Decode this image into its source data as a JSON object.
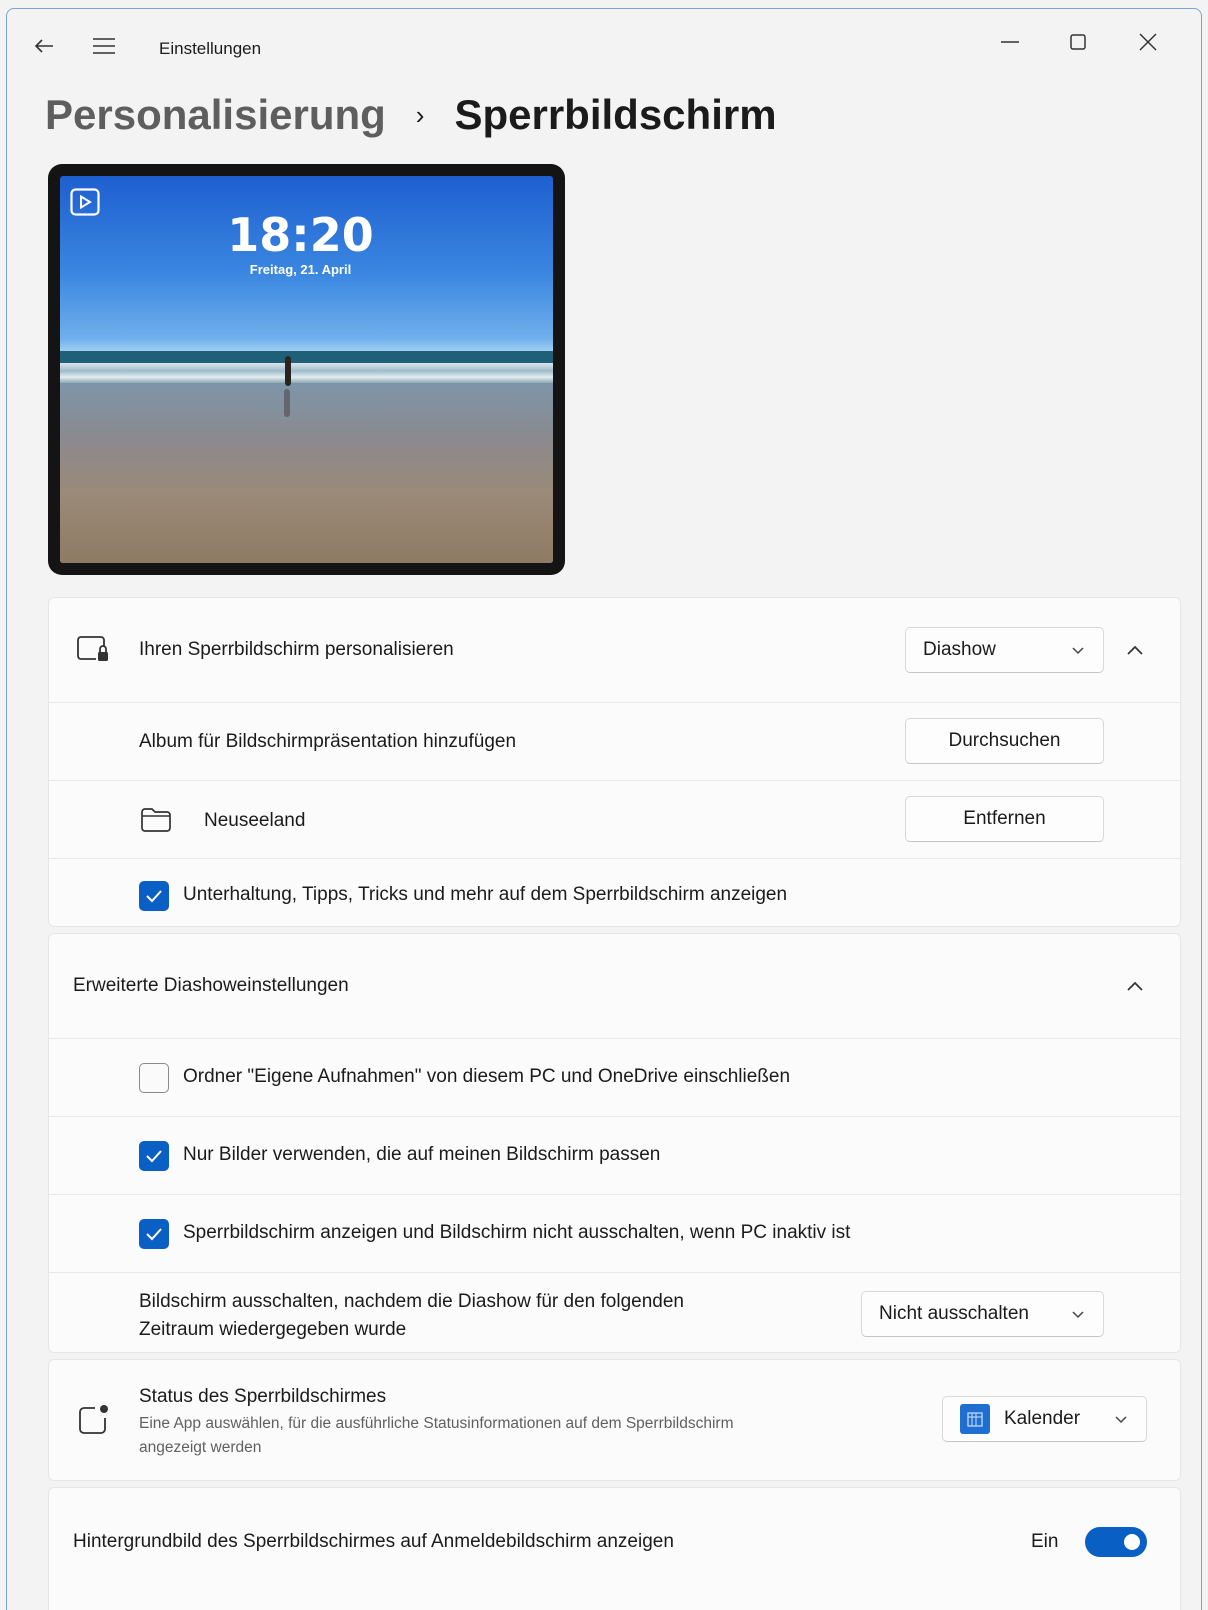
{
  "window": {
    "title": "Einstellungen"
  },
  "breadcrumb": {
    "parent": "Personalisierung",
    "separator": "›",
    "current": "Sperrbildschirm"
  },
  "preview": {
    "time": "18:20",
    "date": "Freitag, 21. April"
  },
  "personalize": {
    "label": "Ihren Sperrbildschirm personalisieren",
    "selected": "Diashow",
    "album_label": "Album für Bildschirmpräsentation hinzufügen",
    "browse_button": "Durchsuchen",
    "folder_name": "Neuseeland",
    "remove_button": "Entfernen",
    "tips_label": "Unterhaltung, Tipps, Tricks und mehr auf dem Sperrbildschirm anzeigen",
    "tips_checked": true
  },
  "slideshow": {
    "header": "Erweiterte Diashoweinstellungen",
    "opt1_label": "Ordner \"Eigene Aufnahmen\" von diesem PC und OneDrive einschließen",
    "opt1_checked": false,
    "opt2_label": "Nur Bilder verwenden, die auf meinen Bildschirm passen",
    "opt2_checked": true,
    "opt3_label": "Sperrbildschirm anzeigen und Bildschirm nicht ausschalten, wenn PC inaktiv ist",
    "opt3_checked": true,
    "timeout_line1": "Bildschirm ausschalten, nachdem die Diashow für den folgenden",
    "timeout_line2": "Zeitraum wiedergegeben wurde",
    "timeout_selected": "Nicht ausschalten"
  },
  "status": {
    "title": "Status des Sperrbildschirmes",
    "desc_line1": "Eine App auswählen, für die ausführliche Statusinformationen auf dem Sperrbildschirm",
    "desc_line2": "angezeigt werden",
    "selected_app": "Kalender"
  },
  "signin": {
    "label": "Hintergrundbild des Sperrbildschirmes auf Anmeldebildschirm anzeigen",
    "state_label": "Ein",
    "on": true
  },
  "colors": {
    "accent": "#0a5fc4",
    "background": "#f3f3f3",
    "card": "#fbfbfb"
  }
}
